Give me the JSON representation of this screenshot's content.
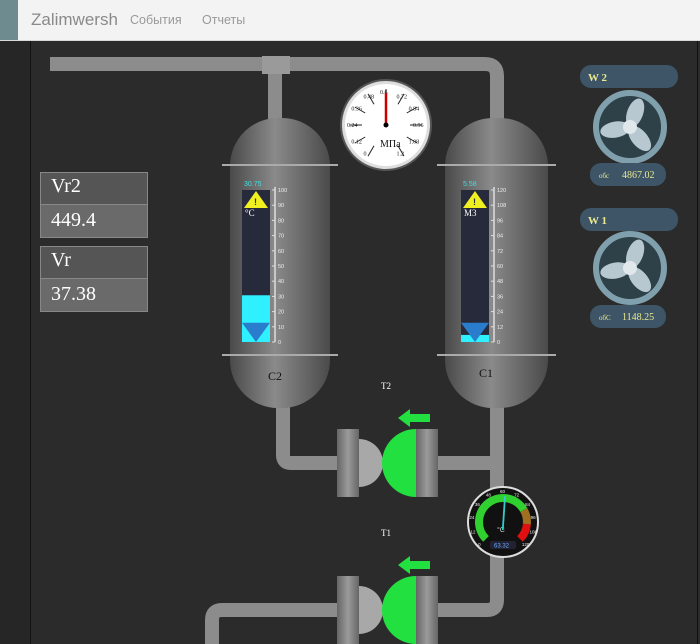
{
  "nav": {
    "brand": "Zalimwersh",
    "links": [
      "События",
      "Отчеты"
    ]
  },
  "panels": [
    {
      "label": "Vr2",
      "value": "449.4"
    },
    {
      "label": "Vr",
      "value": "37.38"
    }
  ],
  "pressure_gauge": {
    "unit": "МПа",
    "ticks": [
      "0",
      "0.12",
      "0.24",
      "0.36",
      "0.48",
      "0.6",
      "0.72",
      "0.84",
      "0.96",
      "1.08",
      "1.2"
    ],
    "value": 0.6
  },
  "tanks": [
    {
      "name": "C2",
      "reading": "30.75",
      "unit": "°C",
      "scale": [
        "0",
        "10",
        "20",
        "30",
        "40",
        "50",
        "60",
        "70",
        "80",
        "90",
        "100"
      ],
      "max": 100,
      "level": 30.75,
      "setpoint": 10,
      "warning": true
    },
    {
      "name": "C1",
      "reading": "5.58",
      "unit": "М3",
      "scale": [
        "0",
        "12",
        "24",
        "36",
        "48",
        "60",
        "72",
        "84",
        "96",
        "108",
        "120"
      ],
      "max": 120,
      "level": 5.58,
      "setpoint": 12,
      "warning": true
    }
  ],
  "pumps": [
    {
      "name": "T2",
      "state": "on",
      "direction": "left"
    },
    {
      "name": "T1",
      "state": "on",
      "direction": "left"
    }
  ],
  "temp_gauge": {
    "unit": "°C",
    "ticks": [
      "0",
      "12",
      "24",
      "36",
      "48",
      "60",
      "72",
      "84",
      "96",
      "108",
      "120"
    ],
    "value": 62,
    "readout": "63.32"
  },
  "fans": [
    {
      "name": "W 2",
      "unit": "обс",
      "value": "4867.02"
    },
    {
      "name": "W 1",
      "unit": "обС",
      "value": "1148.25"
    }
  ],
  "colors": {
    "pipe": "#8c8c8c",
    "tank": "#6b6b6b",
    "fill": "#2ef0ff",
    "pump_on": "#22e040",
    "warning": "#f0f020",
    "fan_panel": "#3d5566",
    "fan_text": "#e8e890"
  }
}
